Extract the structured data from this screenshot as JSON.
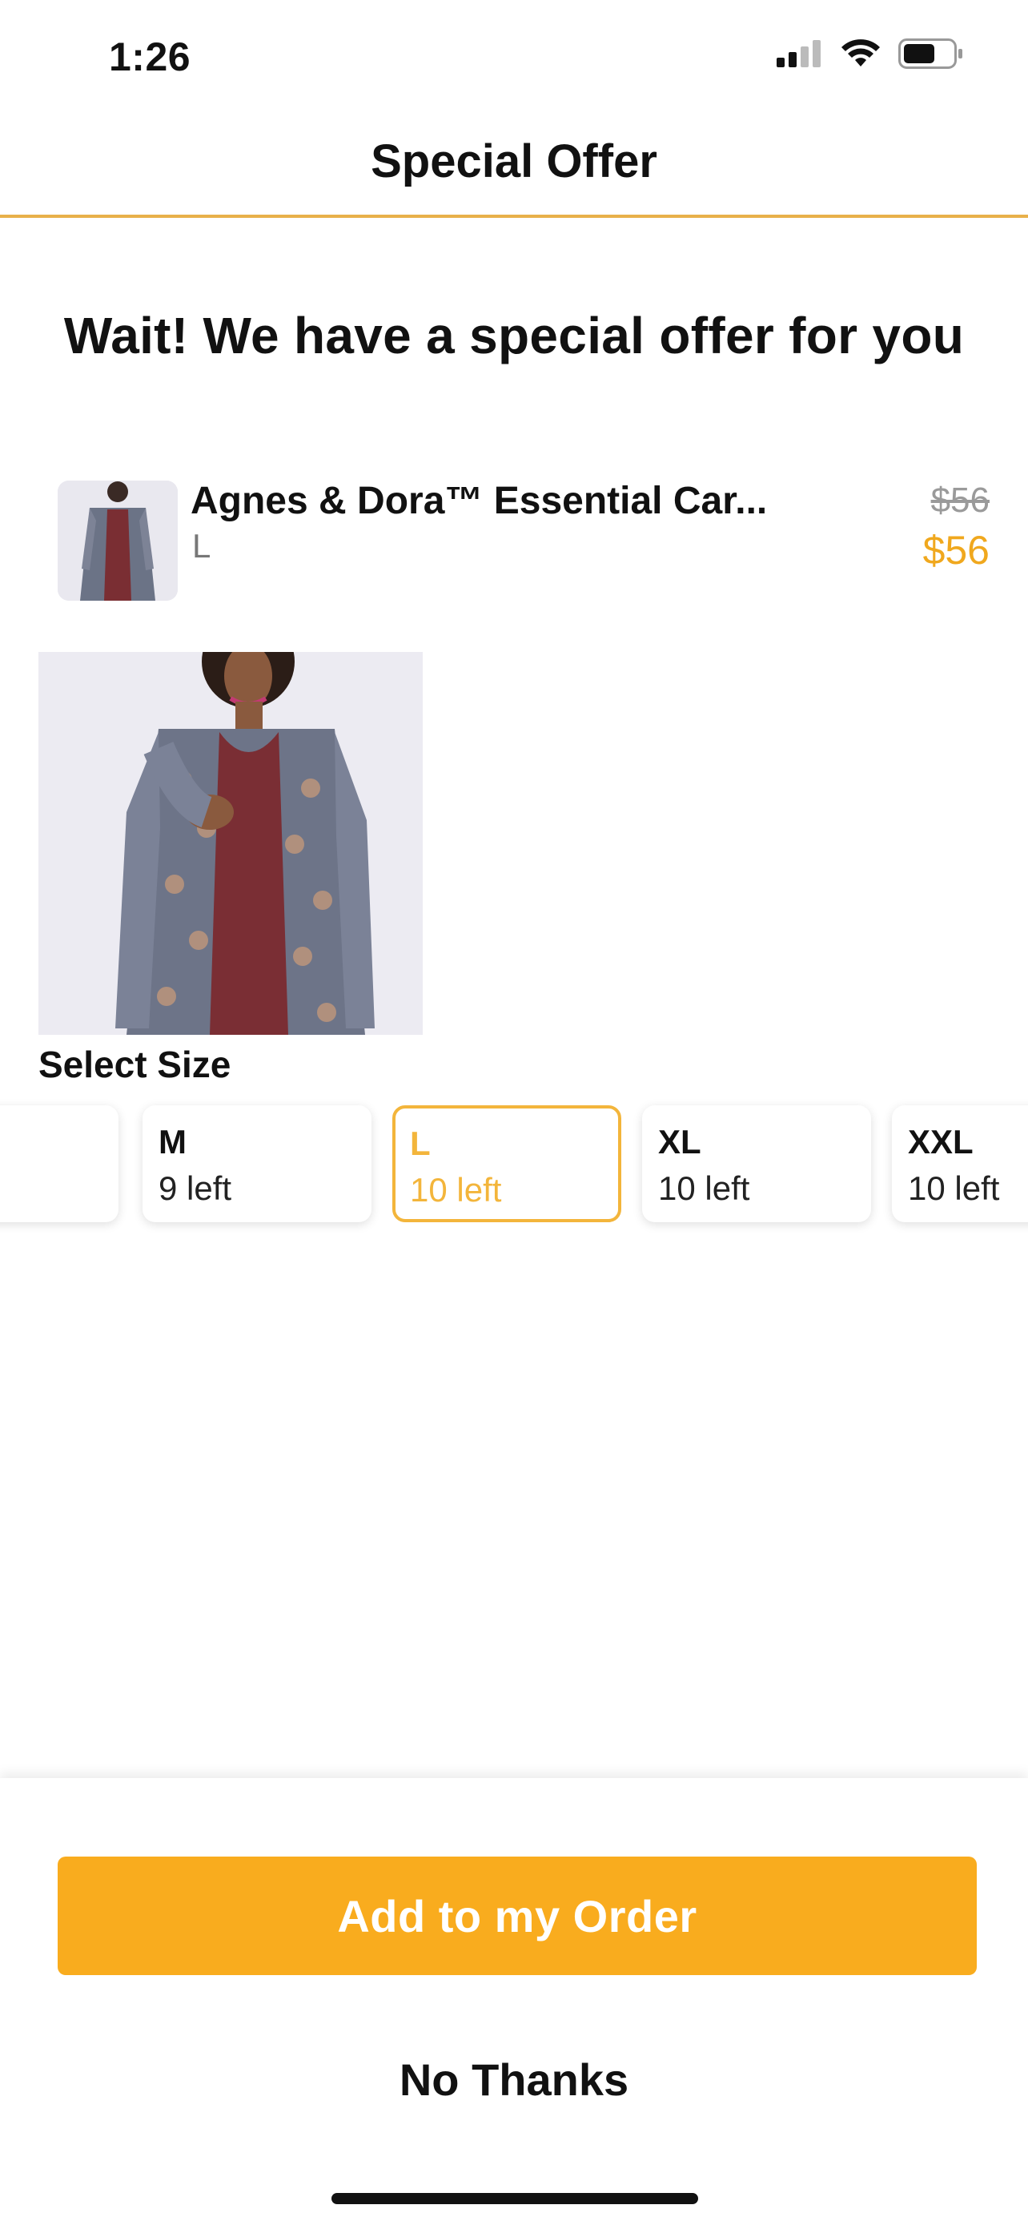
{
  "status_bar": {
    "time": "1:26",
    "icons": [
      "signal-icon",
      "wifi-icon",
      "battery-icon"
    ]
  },
  "nav": {
    "title": "Special Offer"
  },
  "headline": "Wait! We have a special offer for you",
  "product": {
    "name": "Agnes & Dora™ Essential Car...",
    "variant": "L",
    "price_original": "$56",
    "price_offer": "$56"
  },
  "size_section": {
    "title": "Select Size",
    "options": [
      {
        "label": "",
        "stock": ""
      },
      {
        "label": "M",
        "stock": "9 left"
      },
      {
        "label": "L",
        "stock": "10 left"
      },
      {
        "label": "XL",
        "stock": "10 left"
      },
      {
        "label": "XXL",
        "stock": "10 left"
      }
    ],
    "selected": "L"
  },
  "actions": {
    "add_label": "Add to my Order",
    "decline_label": "No Thanks"
  },
  "colors": {
    "accent": "#F9AC1E",
    "selected_border": "#F3B53B",
    "nav_divider": "#E8B04A",
    "price_offer": "#F0A81E"
  }
}
